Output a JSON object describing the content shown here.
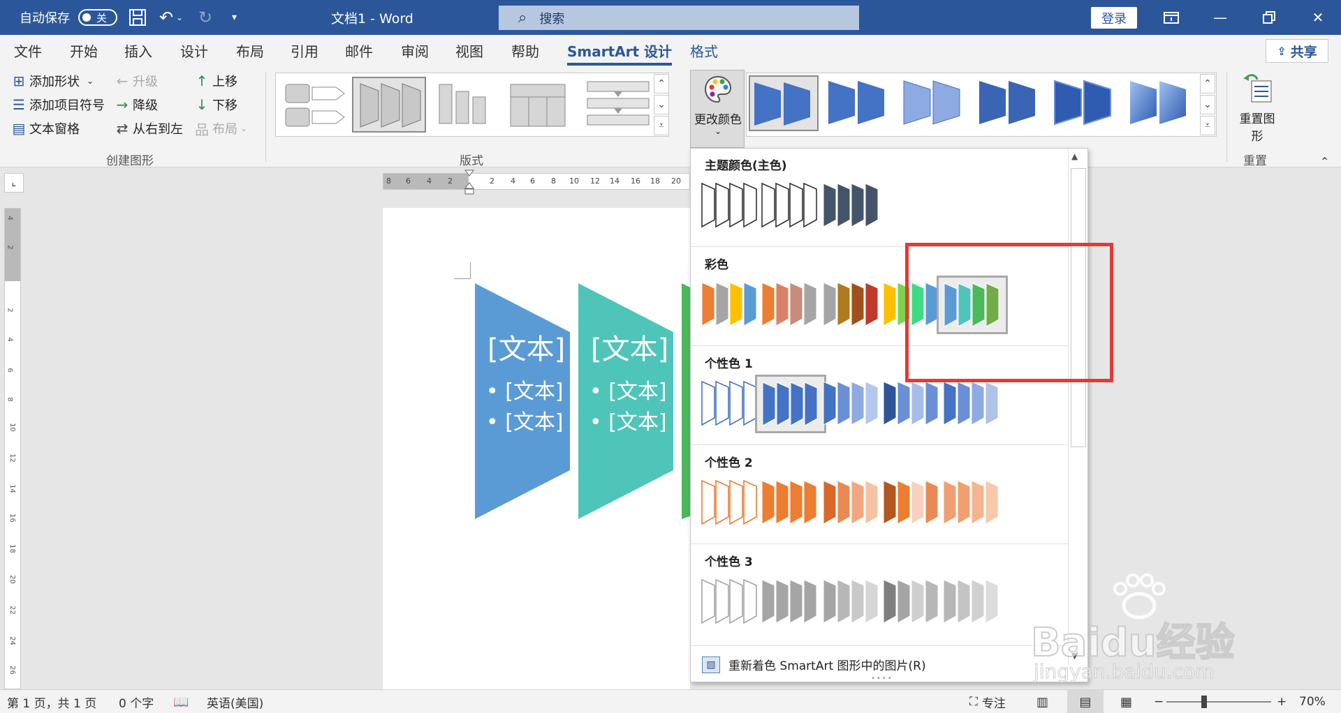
{
  "titlebar": {
    "autosave_label": "自动保存",
    "autosave_state": "关",
    "doc_title": "文档1  -  Word",
    "search_placeholder": "搜索",
    "login_label": "登录"
  },
  "tabs": [
    {
      "label": "文件"
    },
    {
      "label": "开始"
    },
    {
      "label": "插入"
    },
    {
      "label": "设计"
    },
    {
      "label": "布局"
    },
    {
      "label": "引用"
    },
    {
      "label": "邮件"
    },
    {
      "label": "审阅"
    },
    {
      "label": "视图"
    },
    {
      "label": "帮助"
    },
    {
      "label": "SmartArt 设计"
    },
    {
      "label": "格式"
    }
  ],
  "share_label": "共享",
  "ribbon": {
    "create_graphic": {
      "group_label": "创建图形",
      "add_shape": "添加形状",
      "add_bullet": "添加项目符号",
      "text_pane": "文本窗格",
      "promote": "升级",
      "demote": "降级",
      "right_to_left": "从右到左",
      "move_up": "上移",
      "move_down": "下移",
      "layout": "布局"
    },
    "layouts_label": "版式",
    "change_colors_label": "更改颜色",
    "reset_graphic_label": "重置图形",
    "reset_group_label": "重置"
  },
  "ruler": {
    "h_numbers": [
      "8",
      "6",
      "4",
      "2",
      "2",
      "4",
      "6",
      "8",
      "10",
      "12",
      "14",
      "16",
      "18",
      "20"
    ],
    "v_numbers": [
      "4",
      "2",
      "2",
      "4",
      "6",
      "8",
      "10",
      "12",
      "14",
      "16",
      "18",
      "20",
      "22",
      "24",
      "26"
    ]
  },
  "smartart": {
    "shape1_title": "[文本]",
    "shape1_bullet1": "• [文本]",
    "shape1_bullet2": "• [文本]",
    "shape2_title": "[文本]",
    "shape2_bullet1": "• [文本]",
    "shape2_bullet2": "• [文本]",
    "colors": {
      "shape1": "#5b9bd5",
      "shape2": "#4ec5b8",
      "shape3": "#4cb85c"
    }
  },
  "color_menu": {
    "sections": [
      {
        "title": "主题颜色(主色)",
        "swatches": [
          [
            "#ffffff",
            "#ffffff",
            "#ffffff",
            "#ffffff"
          ],
          [
            "#ffffff",
            "#ffffff",
            "#ffffff",
            "#ffffff"
          ],
          [
            "#44546a",
            "#44546a",
            "#44546a",
            "#44546a"
          ]
        ]
      },
      {
        "title": "彩色",
        "swatches": [
          [
            "#ed7d31",
            "#a5a5a5",
            "#ffc000",
            "#5b9bd5"
          ],
          [
            "#ed7d31",
            "#d8826a",
            "#c78c7a",
            "#a5a5a5"
          ],
          [
            "#a5a5a5",
            "#b07a1e",
            "#a0501a",
            "#c0392b"
          ],
          [
            "#ffc000",
            "#7bd34f",
            "#3ddc84",
            "#5b9bd5"
          ],
          [
            "#5b9bd5",
            "#4ec5b8",
            "#4cb85c",
            "#70ad47"
          ]
        ]
      },
      {
        "title": "个性色 1",
        "swatches": [
          [
            "#ffffff",
            "#ffffff",
            "#ffffff",
            "#ffffff"
          ],
          [
            "#4472c4",
            "#4472c4",
            "#4472c4",
            "#4472c4"
          ],
          [
            "#4472c4",
            "#6a8fd6",
            "#8eaae3",
            "#b4c7ee"
          ],
          [
            "#2f5597",
            "#6a8fd6",
            "#a7bde8",
            "#6a8fd6"
          ],
          [
            "#4472c4",
            "#6a8fd6",
            "#8eaae3",
            "#aec2ea"
          ]
        ]
      },
      {
        "title": "个性色 2",
        "swatches": [
          [
            "#ffffff",
            "#ffffff",
            "#ffffff",
            "#ffffff"
          ],
          [
            "#ed7d31",
            "#ed7d31",
            "#ed7d31",
            "#ed7d31"
          ],
          [
            "#d9692a",
            "#e98a55",
            "#f0a77f",
            "#f5c2a4"
          ],
          [
            "#b4561f",
            "#ed7d31",
            "#f8d0c0",
            "#e98a55"
          ],
          [
            "#f0a070",
            "#f0a070",
            "#f4b590",
            "#f7c8aa"
          ]
        ]
      },
      {
        "title": "个性色 3",
        "swatches": [
          [
            "#ffffff",
            "#ffffff",
            "#ffffff",
            "#ffffff"
          ],
          [
            "#a5a5a5",
            "#a5a5a5",
            "#a5a5a5",
            "#a5a5a5"
          ],
          [
            "#a5a5a5",
            "#b7b7b7",
            "#c9c9c9",
            "#d6d6d6"
          ],
          [
            "#7f7f7f",
            "#a5a5a5",
            "#cfcfcf",
            "#b7b7b7"
          ],
          [
            "#b7b7b7",
            "#c4c4c4",
            "#d0d0d0",
            "#dcdcdc"
          ]
        ]
      }
    ],
    "footer_label": "重新着色 SmartArt 图形中的图片(R)"
  },
  "statusbar": {
    "page_info": "第 1 页，共 1 页",
    "word_count": "0 个字",
    "language": "英语(美国)",
    "focus": "专注",
    "zoom_minus": "−",
    "zoom_plus": "+",
    "zoom": "70%"
  },
  "watermark": {
    "brand": "Baidu经验",
    "url": "jingyan.baidu.com"
  }
}
